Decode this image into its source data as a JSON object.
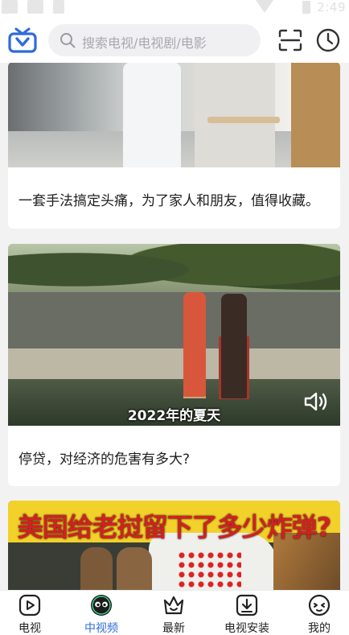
{
  "colors": {
    "accent": "#2f6bd8",
    "background": "#f2f2f2",
    "card": "#ffffff",
    "headline_red": "#d32020",
    "banner_yellow": "#f1d12a"
  },
  "status_bar": {
    "time": "2:49"
  },
  "header": {
    "logo_icon": "tv-logo-icon",
    "search": {
      "placeholder": "搜索电视/电视剧/电影",
      "icon": "search-icon"
    },
    "scan_icon": "scan-icon",
    "history_icon": "clock-icon"
  },
  "feed": [
    {
      "title": "一套手法搞定头痛，为了家人和朋友，值得收藏。"
    },
    {
      "title": "停贷，对经济的危害有多大?",
      "video_caption": "2022年的夏天",
      "volume_icon": "volume-icon"
    },
    {
      "headline": "美国给老挝留下了多少炸弹?"
    }
  ],
  "bottom_nav": {
    "active": "中视频",
    "items": [
      {
        "label": "电视",
        "icon": "play-icon"
      },
      {
        "label": "中视频",
        "icon": "mascot-icon"
      },
      {
        "label": "最新",
        "icon": "crown-icon"
      },
      {
        "label": "电视安装",
        "icon": "download-icon"
      },
      {
        "label": "我的",
        "icon": "face-icon"
      }
    ]
  }
}
